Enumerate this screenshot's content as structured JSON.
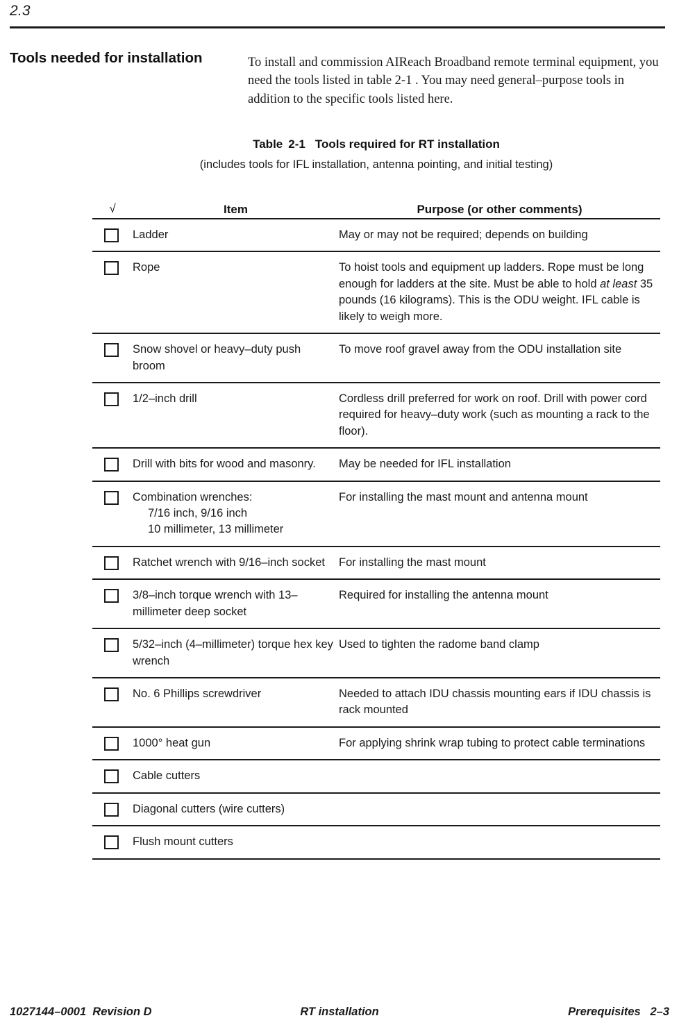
{
  "section": {
    "number": "2.3",
    "title": "Tools needed for installation",
    "intro": "To install and commission AIReach Broadband remote terminal equipment, you need the tools listed in table 2-1 . You may need general–purpose tools in addition to the specific tools listed here."
  },
  "table": {
    "caption_label": "Table",
    "caption_number": "2-1",
    "caption_title": "Tools required for RT installation",
    "subcaption": "(includes tools for IFL installation, antenna pointing, and initial testing)",
    "columns": {
      "check": "√",
      "item": "Item",
      "purpose": "Purpose (or other comments)"
    },
    "rows": [
      {
        "item": "Ladder",
        "item_sub": "",
        "purpose_pre": "May or may not be required; depends on building",
        "purpose_italic": "",
        "purpose_post": ""
      },
      {
        "item": "Rope",
        "item_sub": "",
        "purpose_pre": "To hoist tools and equipment up ladders. Rope must be long enough for ladders at the site. Must be able to hold ",
        "purpose_italic": "at least",
        "purpose_post": " 35 pounds (16 kilograms). This is the ODU weight. IFL cable is likely to weigh more."
      },
      {
        "item": "Snow shovel or heavy–duty push broom",
        "item_sub": "",
        "purpose_pre": "To move roof gravel away from the ODU installation site",
        "purpose_italic": "",
        "purpose_post": ""
      },
      {
        "item": "1/2–inch drill",
        "item_sub": "",
        "purpose_pre": "Cordless drill preferred for work on roof. Drill with power cord required for heavy–duty work (such as mounting a rack to the floor).",
        "purpose_italic": "",
        "purpose_post": ""
      },
      {
        "item": "Drill with bits for wood and masonry.",
        "item_sub": "",
        "purpose_pre": "May be needed for IFL installation",
        "purpose_italic": "",
        "purpose_post": ""
      },
      {
        "item": "Combination wrenches:",
        "item_sub": "7/16 inch, 9/16 inch\n10 millimeter, 13 millimeter",
        "purpose_pre": "For installing the mast mount and antenna mount",
        "purpose_italic": "",
        "purpose_post": ""
      },
      {
        "item": "Ratchet wrench with 9/16–inch socket",
        "item_sub": "",
        "purpose_pre": "For installing the mast mount",
        "purpose_italic": "",
        "purpose_post": ""
      },
      {
        "item": "3/8–inch torque wrench with 13–millimeter deep socket",
        "item_sub": "",
        "purpose_pre": "Required for installing the antenna mount",
        "purpose_italic": "",
        "purpose_post": ""
      },
      {
        "item": "5/32–inch (4–millimeter) torque hex key wrench",
        "item_sub": "",
        "purpose_pre": "Used to tighten the radome band clamp",
        "purpose_italic": "",
        "purpose_post": ""
      },
      {
        "item": "No. 6 Phillips screwdriver",
        "item_sub": "",
        "purpose_pre": "Needed to attach IDU chassis mounting ears if IDU chassis is rack mounted",
        "purpose_italic": "",
        "purpose_post": ""
      },
      {
        "item": "1000° heat gun",
        "item_sub": "",
        "purpose_pre": "For applying shrink wrap tubing to protect cable terminations",
        "purpose_italic": "",
        "purpose_post": ""
      },
      {
        "item": "Cable cutters",
        "item_sub": "",
        "purpose_pre": "",
        "purpose_italic": "",
        "purpose_post": ""
      },
      {
        "item": "Diagonal cutters (wire cutters)",
        "item_sub": "",
        "purpose_pre": "",
        "purpose_italic": "",
        "purpose_post": ""
      },
      {
        "item": "Flush mount cutters",
        "item_sub": "",
        "purpose_pre": "",
        "purpose_italic": "",
        "purpose_post": ""
      }
    ]
  },
  "footer": {
    "left": "1027144–0001  Revision D",
    "center": "RT installation",
    "right": "Prerequisites   2–3"
  },
  "colors": {
    "text": "#1a1a1a",
    "rule": "#1a1a1a",
    "background": "#ffffff"
  }
}
